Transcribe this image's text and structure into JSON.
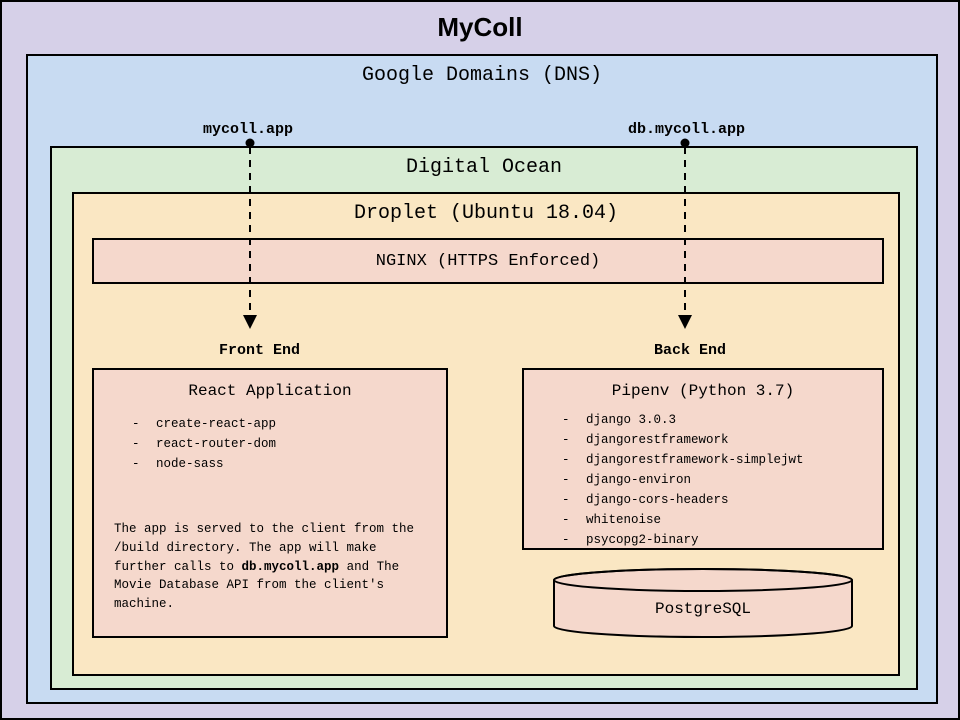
{
  "title": "MyColl",
  "dns": {
    "title": "Google Domains (DNS)",
    "left_domain": "mycoll.app",
    "right_domain": "db.mycoll.app"
  },
  "hosting": {
    "title": "Digital Ocean",
    "droplet": {
      "title": "Droplet (Ubuntu 18.04)",
      "nginx": "NGINX (HTTPS Enforced)",
      "frontend_label": "Front End",
      "backend_label": "Back End",
      "react": {
        "title": "React Application",
        "packages": [
          "create-react-app",
          "react-router-dom",
          "node-sass"
        ],
        "note_prefix": "The app is served to the client from the /build directory. The app will make further calls to ",
        "note_bold": "db.mycoll.app",
        "note_suffix": " and The Movie Database API from the client's machine."
      },
      "pipenv": {
        "title": "Pipenv (Python 3.7)",
        "packages": [
          "django 3.0.3",
          "djangorestframework",
          "djangorestframework-simplejwt",
          "django-environ",
          "django-cors-headers",
          "whitenoise",
          "psycopg2-binary"
        ]
      },
      "database": "PostgreSQL"
    }
  }
}
